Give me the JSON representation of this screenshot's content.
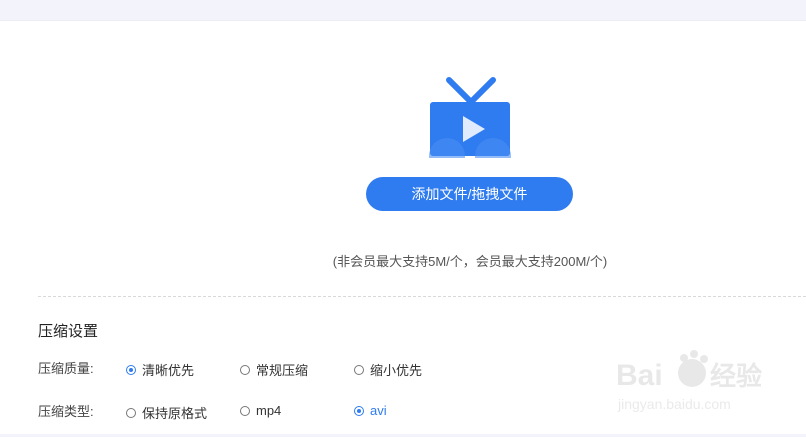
{
  "upload": {
    "icon": "tv-play-icon",
    "add_button_label": "添加文件/拖拽文件",
    "limit_note": "(非会员最大支持5M/个，会员最大支持200M/个)"
  },
  "settings": {
    "title": "压缩设置",
    "quality": {
      "label": "压缩质量:",
      "options": [
        {
          "label": "清晰优先",
          "selected": true
        },
        {
          "label": "常规压缩",
          "selected": false
        },
        {
          "label": "缩小优先",
          "selected": false
        }
      ]
    },
    "type": {
      "label": "压缩类型:",
      "options": [
        {
          "label": "保持原格式",
          "selected": false
        },
        {
          "label": "mp4",
          "selected": false
        },
        {
          "label": "avi",
          "selected": true
        }
      ]
    }
  },
  "watermark": {
    "brand": "Baidu经验",
    "url": "jingyan.baidu.com"
  },
  "colors": {
    "accent": "#2f7cf0",
    "background": "#f3f4fb"
  }
}
